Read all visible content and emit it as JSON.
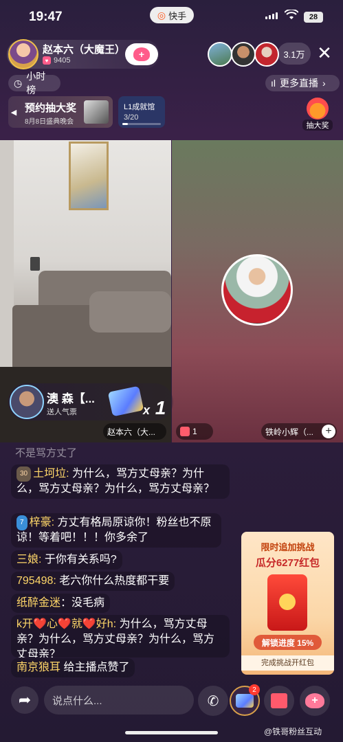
{
  "status_bar": {
    "time": "19:47",
    "app": "快手",
    "battery": "28"
  },
  "host": {
    "name": "赵本六（大魔王）",
    "likes": "9405"
  },
  "viewers": {
    "count": "3.1万"
  },
  "pills": {
    "hour_rank": "小时榜",
    "more_live": "更多直播"
  },
  "lottery_banner": {
    "title": "预约抽大奖",
    "subtitle": "8月8日盛典晚会"
  },
  "level_banner": {
    "title": "L1成就馆",
    "progress": "3/20",
    "progress_fraction": 0.15
  },
  "draw_button": {
    "label": "抽大奖"
  },
  "gift_card": {
    "name": "澳 森【...",
    "desc": "送人气票",
    "combo_x": "x",
    "combo_n": "1"
  },
  "tags": {
    "host": "赵本六（大...",
    "gift_count": "1",
    "guest": "铁岭小辉（..."
  },
  "chat": {
    "faded": "不是骂方丈了",
    "messages": [
      {
        "badge": "30",
        "user": "土坷垃:",
        "text": "为什么，骂方丈母亲？为什么，骂方丈母亲？为什么，骂方丈母亲？"
      },
      {
        "badge": "7",
        "user": "梓豪:",
        "text": "方丈有格局原谅你！粉丝也不原谅！等着吧！！！你多余了"
      },
      {
        "user": "三娘:",
        "text": "于你有关系吗?"
      },
      {
        "user": "795498:",
        "text": "老六你什么热度都干要"
      },
      {
        "user": "纸醉金迷",
        "text": "：没毛病"
      },
      {
        "user": "k开❤️心❤️就❤️好h:",
        "text": "为什么，骂方丈母亲？为什么，骂方丈母亲？为什么，骂方丈母亲？"
      },
      {
        "user": "南京狼耳",
        "text": "给主播点赞了"
      }
    ]
  },
  "challenge": {
    "title": "限时追加挑战",
    "reward": "瓜分6277红包",
    "progress": "解锁进度 15%",
    "footer": "完成挑战开红包"
  },
  "bottom_bar": {
    "input_placeholder": "说点什么...",
    "ticket_badge": "2"
  },
  "watermark": "@铁哥粉丝互动"
}
